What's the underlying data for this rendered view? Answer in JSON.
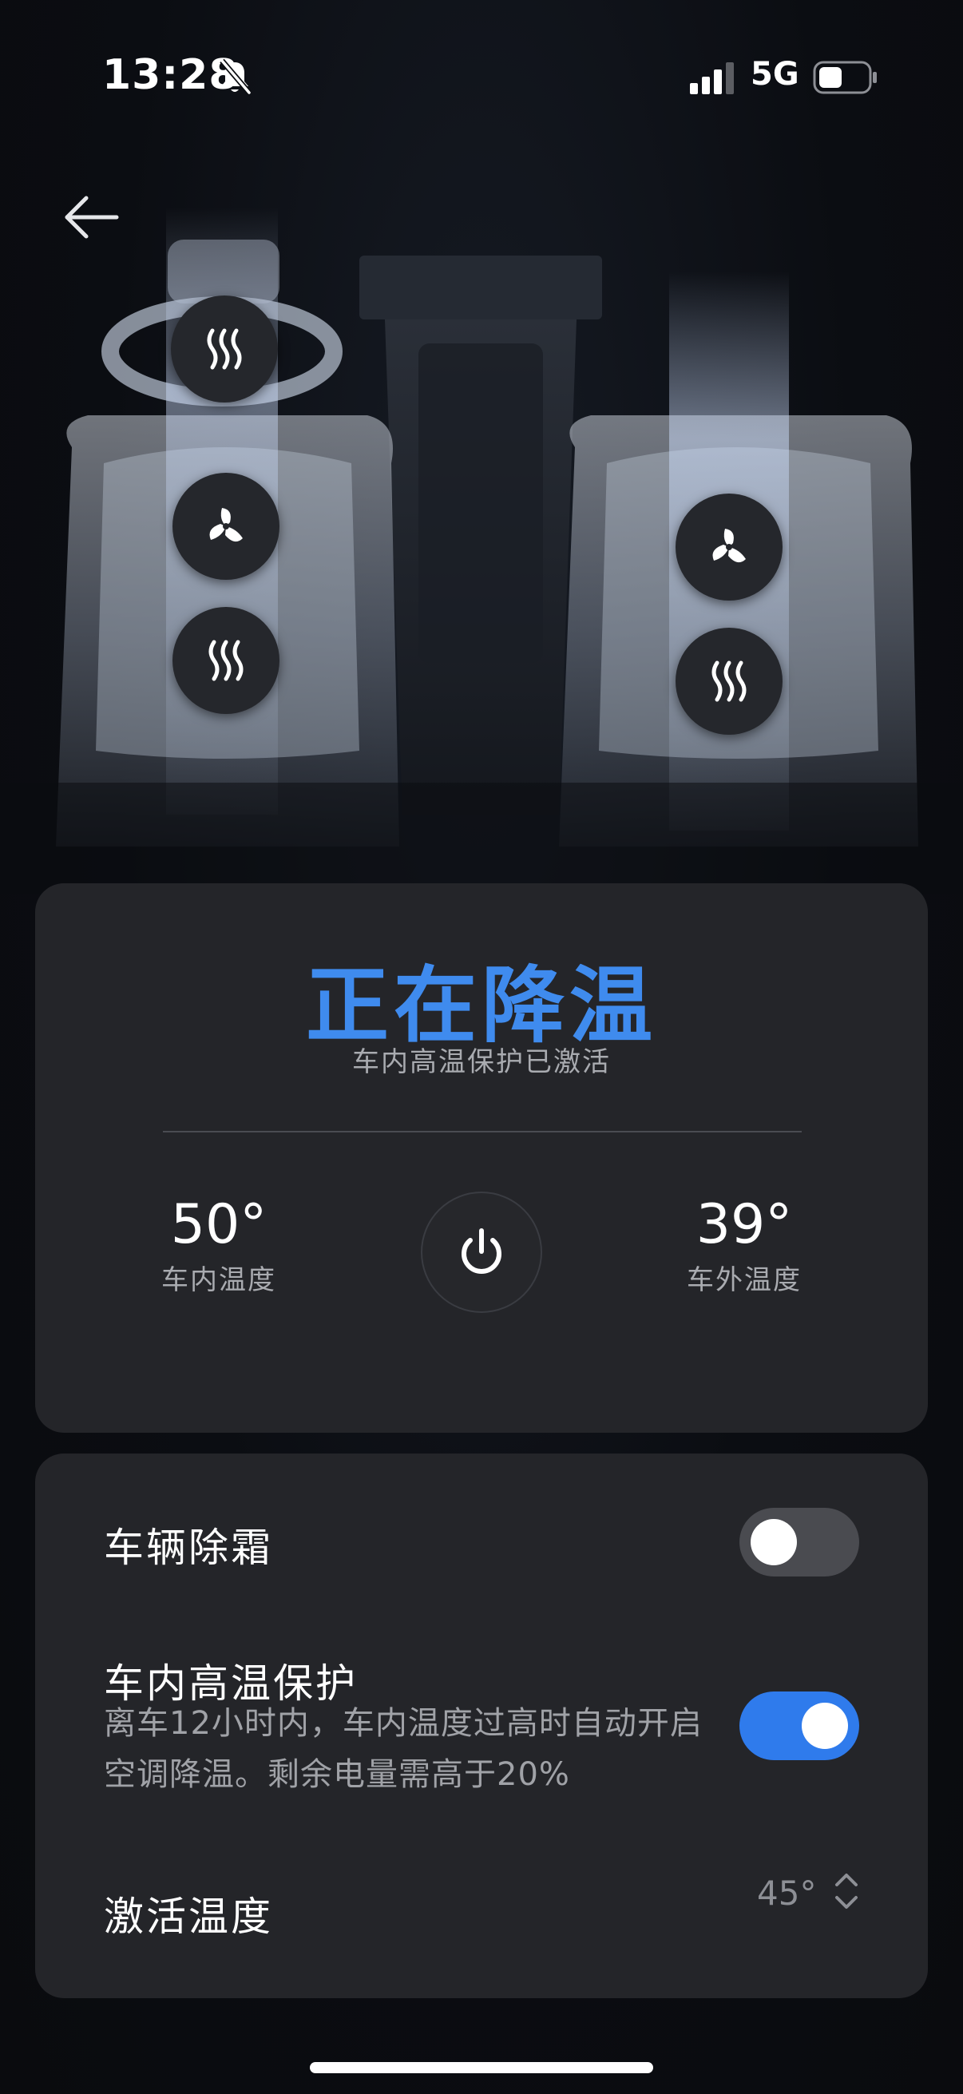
{
  "status_bar": {
    "time": "13:28",
    "network": "5G",
    "icons": [
      "bell-muted-icon",
      "signal-icon",
      "battery-icon"
    ]
  },
  "nav": {
    "back_icon": "arrow-left-icon"
  },
  "car_controls": {
    "left_steering_heat": "heat-waves-icon",
    "left_seat_vent": "fan-icon",
    "left_seat_heat": "heat-waves-icon",
    "right_seat_vent": "fan-icon",
    "right_seat_heat": "heat-waves-icon"
  },
  "status": {
    "title": "正在降温",
    "subtitle": "车内高温保护已激活",
    "inside_temp": "50°",
    "inside_label": "车内温度",
    "outside_temp": "39°",
    "outside_label": "车外温度",
    "power_icon": "power-icon"
  },
  "settings": {
    "defrost_label": "车辆除霜",
    "defrost_on": false,
    "heat_protect_label": "车内高温保护",
    "heat_protect_desc": "离车12小时内，车内温度过高时自动开启空调降温。剩余电量需高于20%",
    "heat_protect_on": true,
    "activation_label": "激活温度",
    "activation_value": "45°"
  },
  "colors": {
    "accent": "#3f8bee",
    "toggle_on": "#2f7bec",
    "card_bg": "#242529",
    "background": "#0b0d11"
  }
}
